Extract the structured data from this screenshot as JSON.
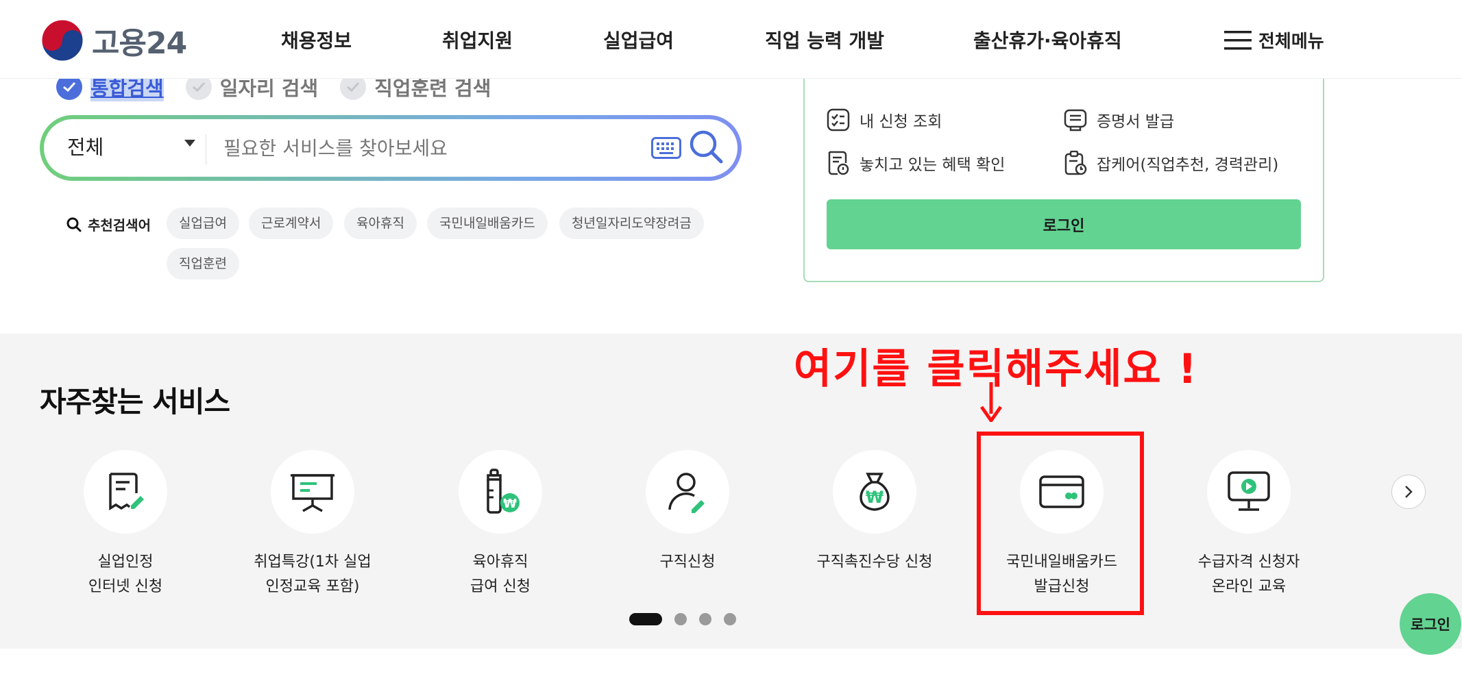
{
  "header": {
    "logo_text": "고용24",
    "nav": [
      "채용정보",
      "취업지원",
      "실업급여",
      "직업 능력 개발",
      "출산휴가·육아휴직"
    ],
    "all_menu_label": "전체메뉴"
  },
  "search": {
    "tabs": [
      "통합검색",
      "일자리 검색",
      "직업훈련 검색"
    ],
    "active_tab": 0,
    "scope_value": "전체",
    "placeholder": "필요한 서비스를 찾아보세요",
    "recommended_label": "추천검색어",
    "recommended": [
      "실업급여",
      "근로계약서",
      "육아휴직",
      "국민내일배움카드",
      "청년일자리도약장려금",
      "직업훈련"
    ]
  },
  "login_panel": {
    "links": [
      "내 신청 조회",
      "증명서 발급",
      "놓치고 있는 혜택 확인",
      "잡케어(직업추천, 경력관리)"
    ],
    "login_label": "로그인"
  },
  "services": {
    "title": "자주찾는 서비스",
    "items": [
      {
        "label": "실업인정\n인터넷 신청",
        "icon": "receipt-pen-icon"
      },
      {
        "label": "취업특강(1차 실업\n인정교육 포함)",
        "icon": "presentation-board-icon"
      },
      {
        "label": "육아휴직\n급여 신청",
        "icon": "baby-bottle-won-icon"
      },
      {
        "label": "구직신청",
        "icon": "person-pen-icon"
      },
      {
        "label": "구직촉진수당 신청",
        "icon": "money-bag-won-icon"
      },
      {
        "label": "국민내일배움카드\n발급신청",
        "icon": "card-icon"
      },
      {
        "label": "수급자격 신청자\n온라인 교육",
        "icon": "monitor-play-icon"
      }
    ],
    "page_count": 4,
    "active_page": 0
  },
  "annotation": {
    "text": "여기를 클릭해주세요 !",
    "color": "#ff1111"
  },
  "floating_login_label": "로그인",
  "colors": {
    "accent_green": "#62d391",
    "accent_blue": "#4b6edb",
    "icon_green": "#2fc27a"
  }
}
